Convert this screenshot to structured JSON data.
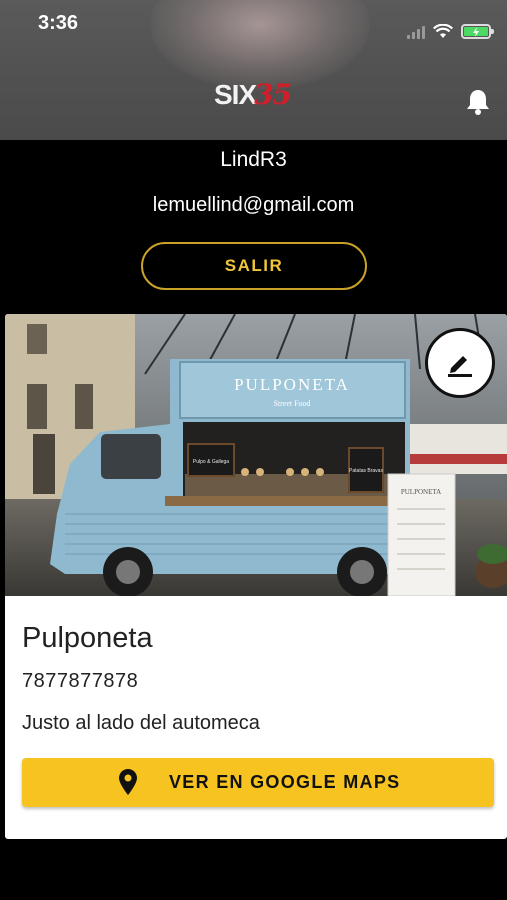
{
  "status_bar": {
    "time": "3:36"
  },
  "header": {
    "logo_text": "SIX",
    "logo_number": "35"
  },
  "profile": {
    "username": "LindR3",
    "email": "lemuellind@gmail.com",
    "logout_label": "SALIR"
  },
  "truck": {
    "sign_text": "PULPONETA",
    "sign_subtext": "Street Food",
    "chalk_left": "Pulpo & Gallega",
    "chalk_right": "Patatas Bravas",
    "menu_title": "PULPONETA"
  },
  "business": {
    "name": "Pulponeta",
    "phone": "7877877878",
    "description": "Justo al lado del automeca",
    "maps_label": "VER EN GOOGLE MAPS"
  },
  "colors": {
    "accent": "#f6c320",
    "outline_accent": "#c9a227",
    "logo_red": "#d11f2a",
    "truck_blue": "#8fb9cf"
  }
}
